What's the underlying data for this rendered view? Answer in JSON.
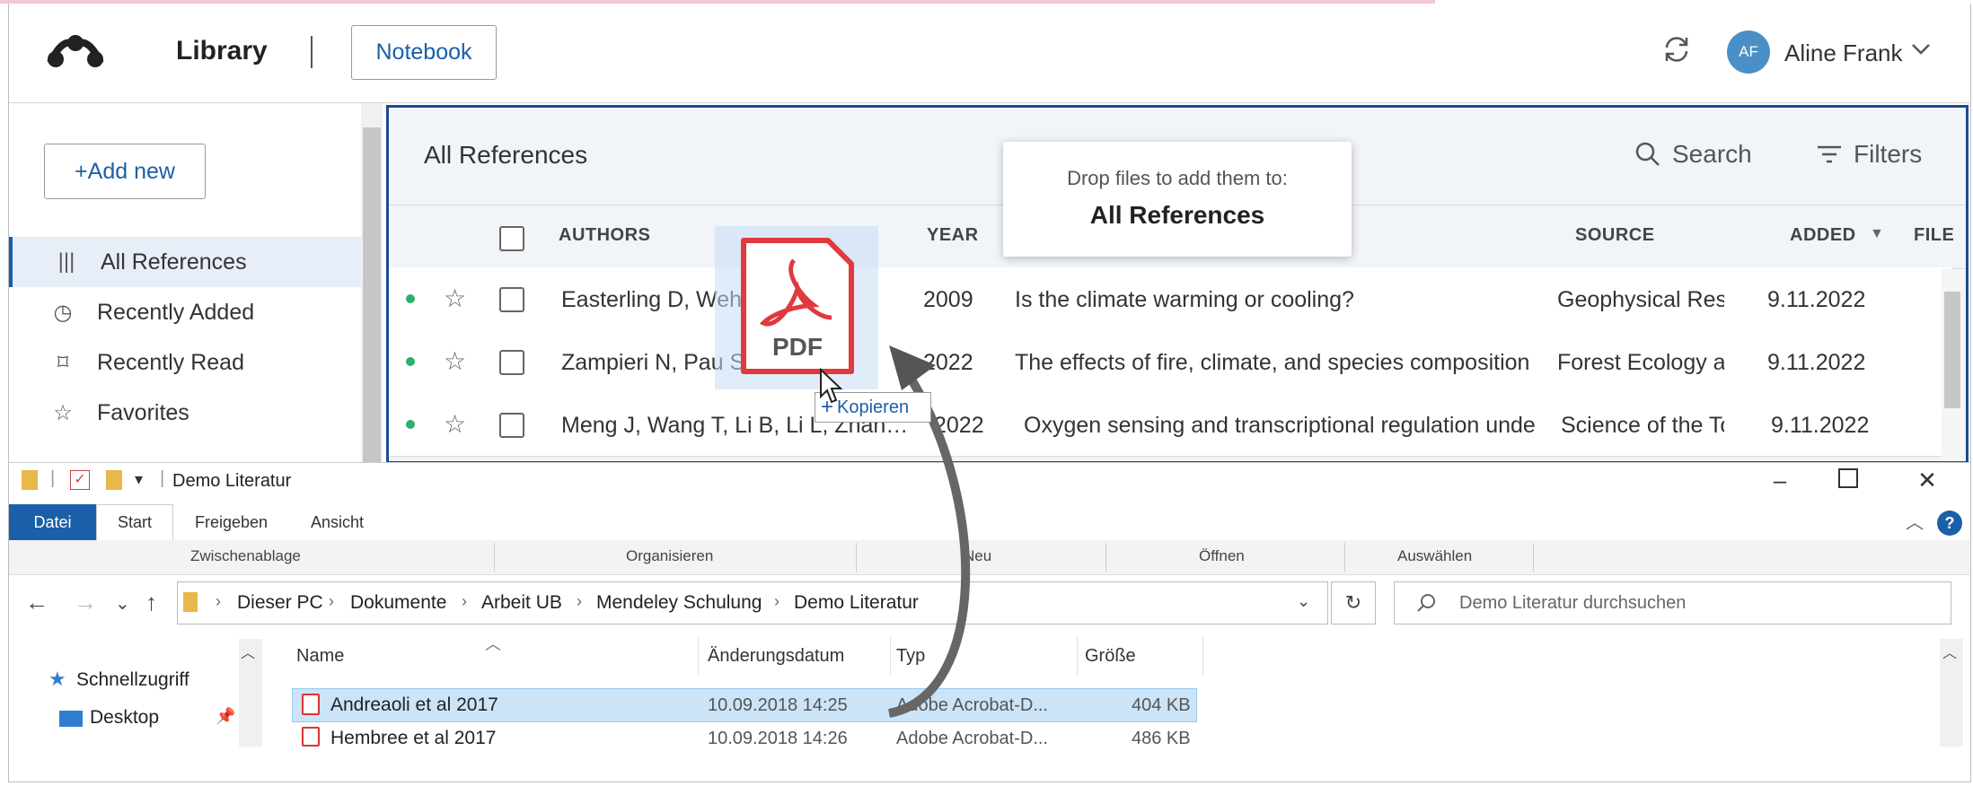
{
  "header": {
    "app_section": "Library",
    "notebook_button": "Notebook",
    "user_initials": "AF",
    "user_name": "Aline Frank"
  },
  "sidebar": {
    "add_new": "+Add new",
    "items": [
      {
        "label": "All References",
        "icon": "library-icon",
        "active": true
      },
      {
        "label": "Recently Added",
        "icon": "clock-icon"
      },
      {
        "label": "Recently Read",
        "icon": "bookmark-icon"
      },
      {
        "label": "Favorites",
        "icon": "star-icon"
      }
    ]
  },
  "main": {
    "title": "All References",
    "search_label": "Search",
    "filters_label": "Filters",
    "columns": {
      "authors": "AUTHORS",
      "year": "YEAR",
      "source": "SOURCE",
      "added": "ADDED",
      "file": "FILE"
    },
    "rows": [
      {
        "authors": "Easterling D, Wehner M",
        "year": "2009",
        "title": "Is the climate warming or cooling?",
        "source": "Geophysical Resea",
        "added": "9.11.2022"
      },
      {
        "authors": "Zampieri N, Pau S",
        "year": "2022",
        "title": "The effects of fire, climate, and species composition c",
        "source": "Forest Ecology anc",
        "added": "9.11.2022"
      },
      {
        "authors": "Meng J, Wang T, Li B, Li L, Zhan…",
        "year": "2022",
        "title": "Oxygen sensing and transcriptional regulation under",
        "source": "Science of the Tota",
        "added": "9.11.2022"
      }
    ],
    "drop_hint": {
      "line1": "Drop files to add them to:",
      "line2": "All References"
    }
  },
  "drag": {
    "pdf_label": "PDF",
    "copy_label": "Kopieren"
  },
  "explorer": {
    "window_title": "Demo Literatur",
    "ribbon_tabs": [
      "Datei",
      "Start",
      "Freigeben",
      "Ansicht"
    ],
    "groups": [
      "Zwischenablage",
      "Organisieren",
      "Neu",
      "Öffnen",
      "Auswählen"
    ],
    "breadcrumb": [
      "Dieser PC",
      "Dokumente",
      "Arbeit UB",
      "Mendeley Schulung",
      "Demo Literatur"
    ],
    "search_placeholder": "Demo Literatur durchsuchen",
    "nav": {
      "quick_access": "Schnellzugriff",
      "desktop": "Desktop"
    },
    "columns": {
      "name": "Name",
      "modified": "Änderungsdatum",
      "type": "Typ",
      "size": "Größe"
    },
    "files": [
      {
        "name": "Andreaoli et al 2017",
        "modified": "10.09.2018 14:25",
        "type": "Adobe Acrobat-D...",
        "size": "404 KB",
        "selected": true
      },
      {
        "name": "Hembree et al 2017",
        "modified": "10.09.2018 14:26",
        "type": "Adobe Acrobat-D...",
        "size": "486 KB"
      }
    ]
  },
  "colors": {
    "accent": "#1a5fa8",
    "border_focus": "#1a4b8f",
    "unread_dot": "#2eae6c",
    "pdf_red": "#e0393e"
  }
}
